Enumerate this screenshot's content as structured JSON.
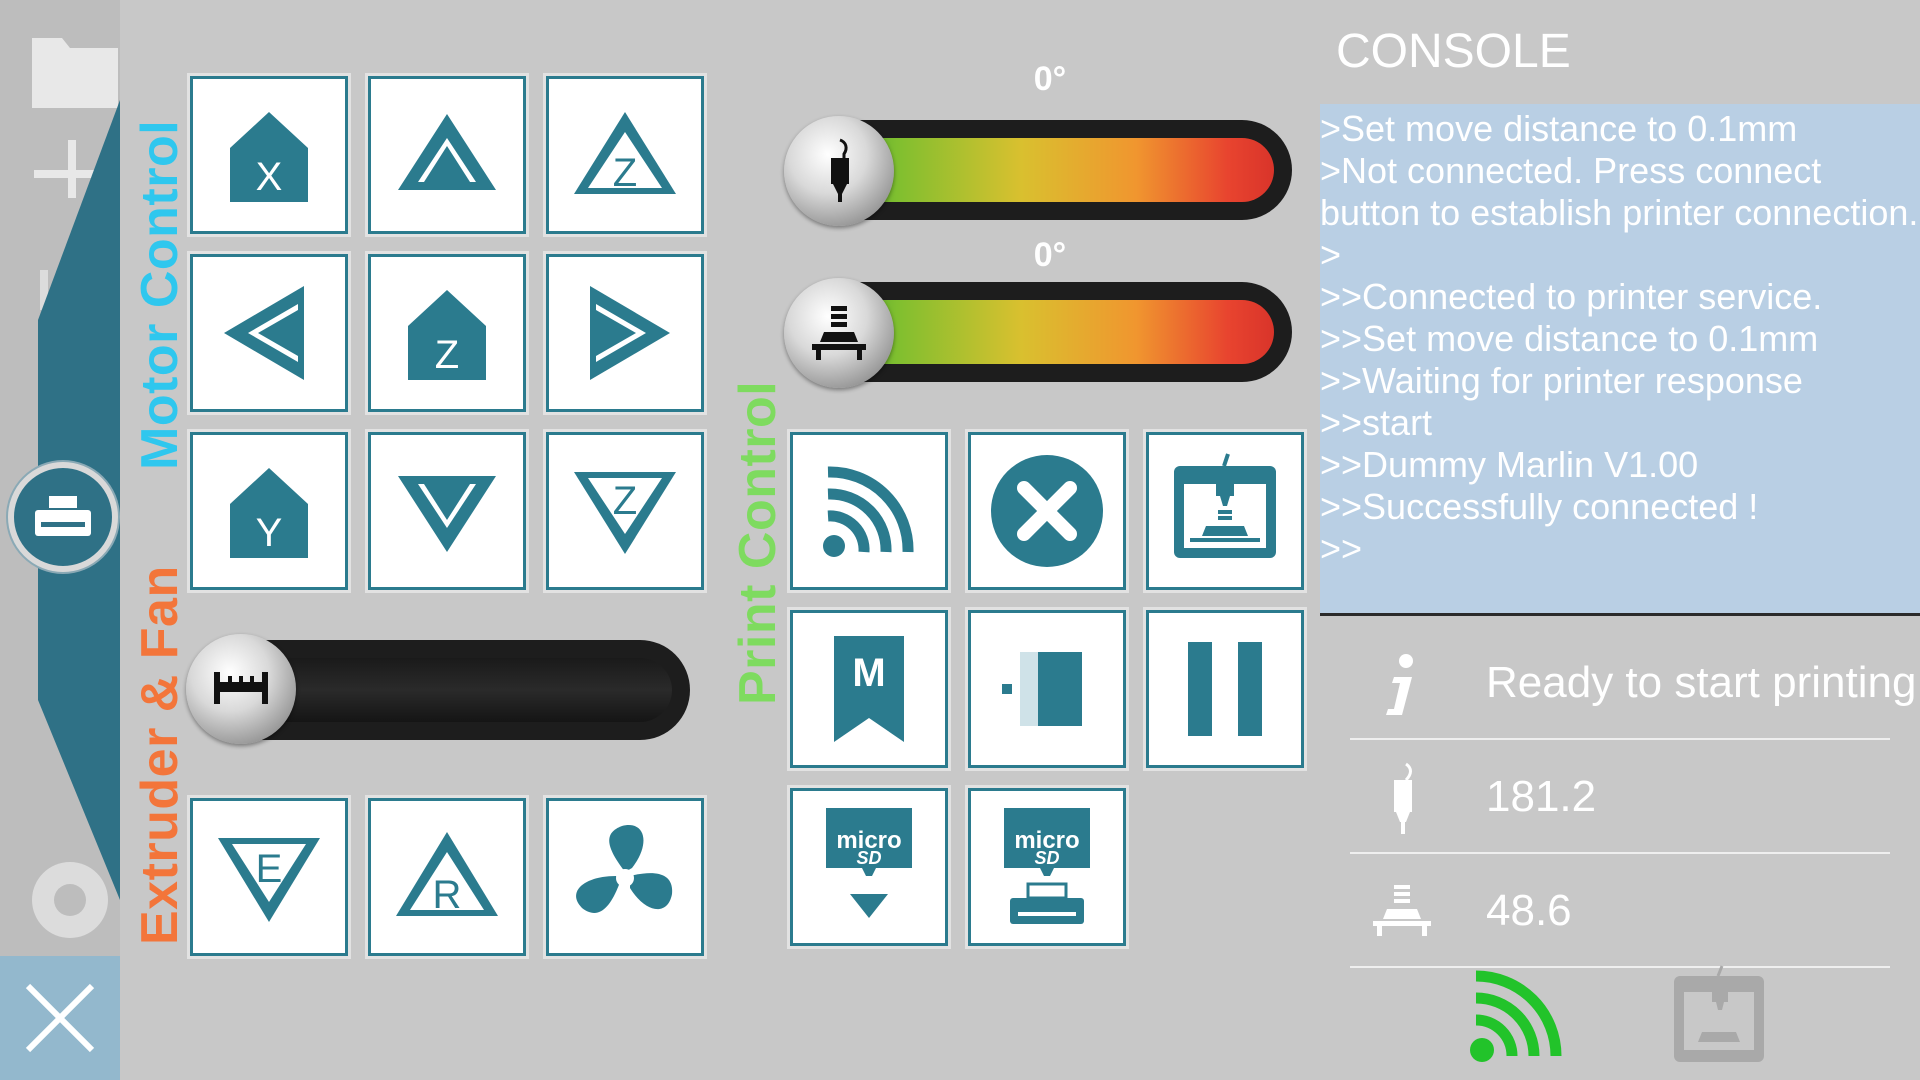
{
  "sections": {
    "motor_control": "Motor Control",
    "extruder_fan": "Extruder & Fan",
    "print_control": "Print Control"
  },
  "motor_buttons": {
    "home_x": "X",
    "home_z": "Z",
    "home_y": "Y",
    "z_up": "Z",
    "z_down": "Z"
  },
  "extruder_buttons": {
    "extrude": "E",
    "retract": "R"
  },
  "temperatures": {
    "extruder_target": "0°",
    "bed_target": "0°"
  },
  "console": {
    "title": "CONSOLE",
    "lines": [
      ">Set move distance to 0.1mm",
      ">Not connected. Press connect button to establish printer connection.",
      ">",
      ">>Connected to printer service.",
      ">>Set move distance to 0.1mm",
      ">>Waiting for printer response",
      ">>start",
      ">>Dummy Marlin V1.00",
      ">>Successfully connected !",
      ">>"
    ]
  },
  "status": {
    "message": "Ready to start printing",
    "extruder_temp": "181.2",
    "bed_temp": "48.6"
  },
  "colors": {
    "accent": "#2b7b8e",
    "motor_label": "#2fc7ee",
    "extruder_label": "#f3753a",
    "print_label": "#7edb5f",
    "wifi_connected": "#22c32a",
    "console_bg": "#b9cfe4"
  },
  "icons": {
    "left_rail_close": "close-icon",
    "left_rail_knob": "printer-icon",
    "connect": "wifi-icon",
    "stop": "stop-icon",
    "print": "printer-icon",
    "gcode": "m-bookmark-icon",
    "sd_card": "microsd-icon"
  }
}
